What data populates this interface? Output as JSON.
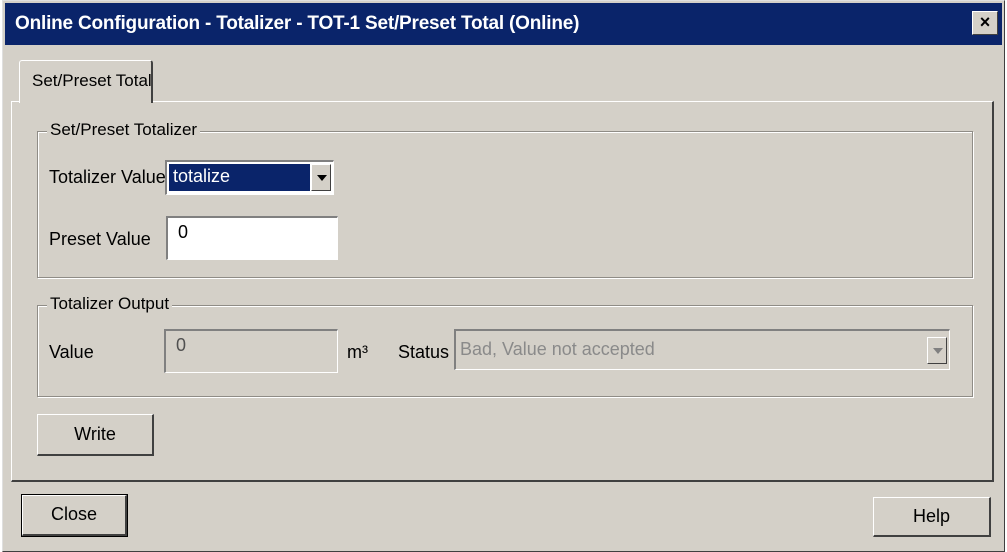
{
  "window": {
    "title": "Online Configuration - Totalizer - TOT-1 Set/Preset Total  (Online)",
    "close_glyph": "×"
  },
  "tabs": [
    {
      "label": "Set/Preset Total"
    }
  ],
  "set_preset_group": {
    "title": "Set/Preset Totalizer",
    "totalizer_value_label": "Totalizer Value",
    "totalizer_value_selected": "totalize",
    "preset_value_label": "Preset Value",
    "preset_value": "0"
  },
  "output_group": {
    "title": "Totalizer Output",
    "value_label": "Value",
    "value": "0",
    "unit": "m³",
    "status_label": "Status",
    "status_value": "Bad, Value not accepted"
  },
  "buttons": {
    "write": "Write",
    "close": "Close",
    "help": "Help"
  },
  "colors": {
    "titlebar": "#0a246a",
    "face": "#d4d0c8",
    "selection": "#0a246a"
  }
}
